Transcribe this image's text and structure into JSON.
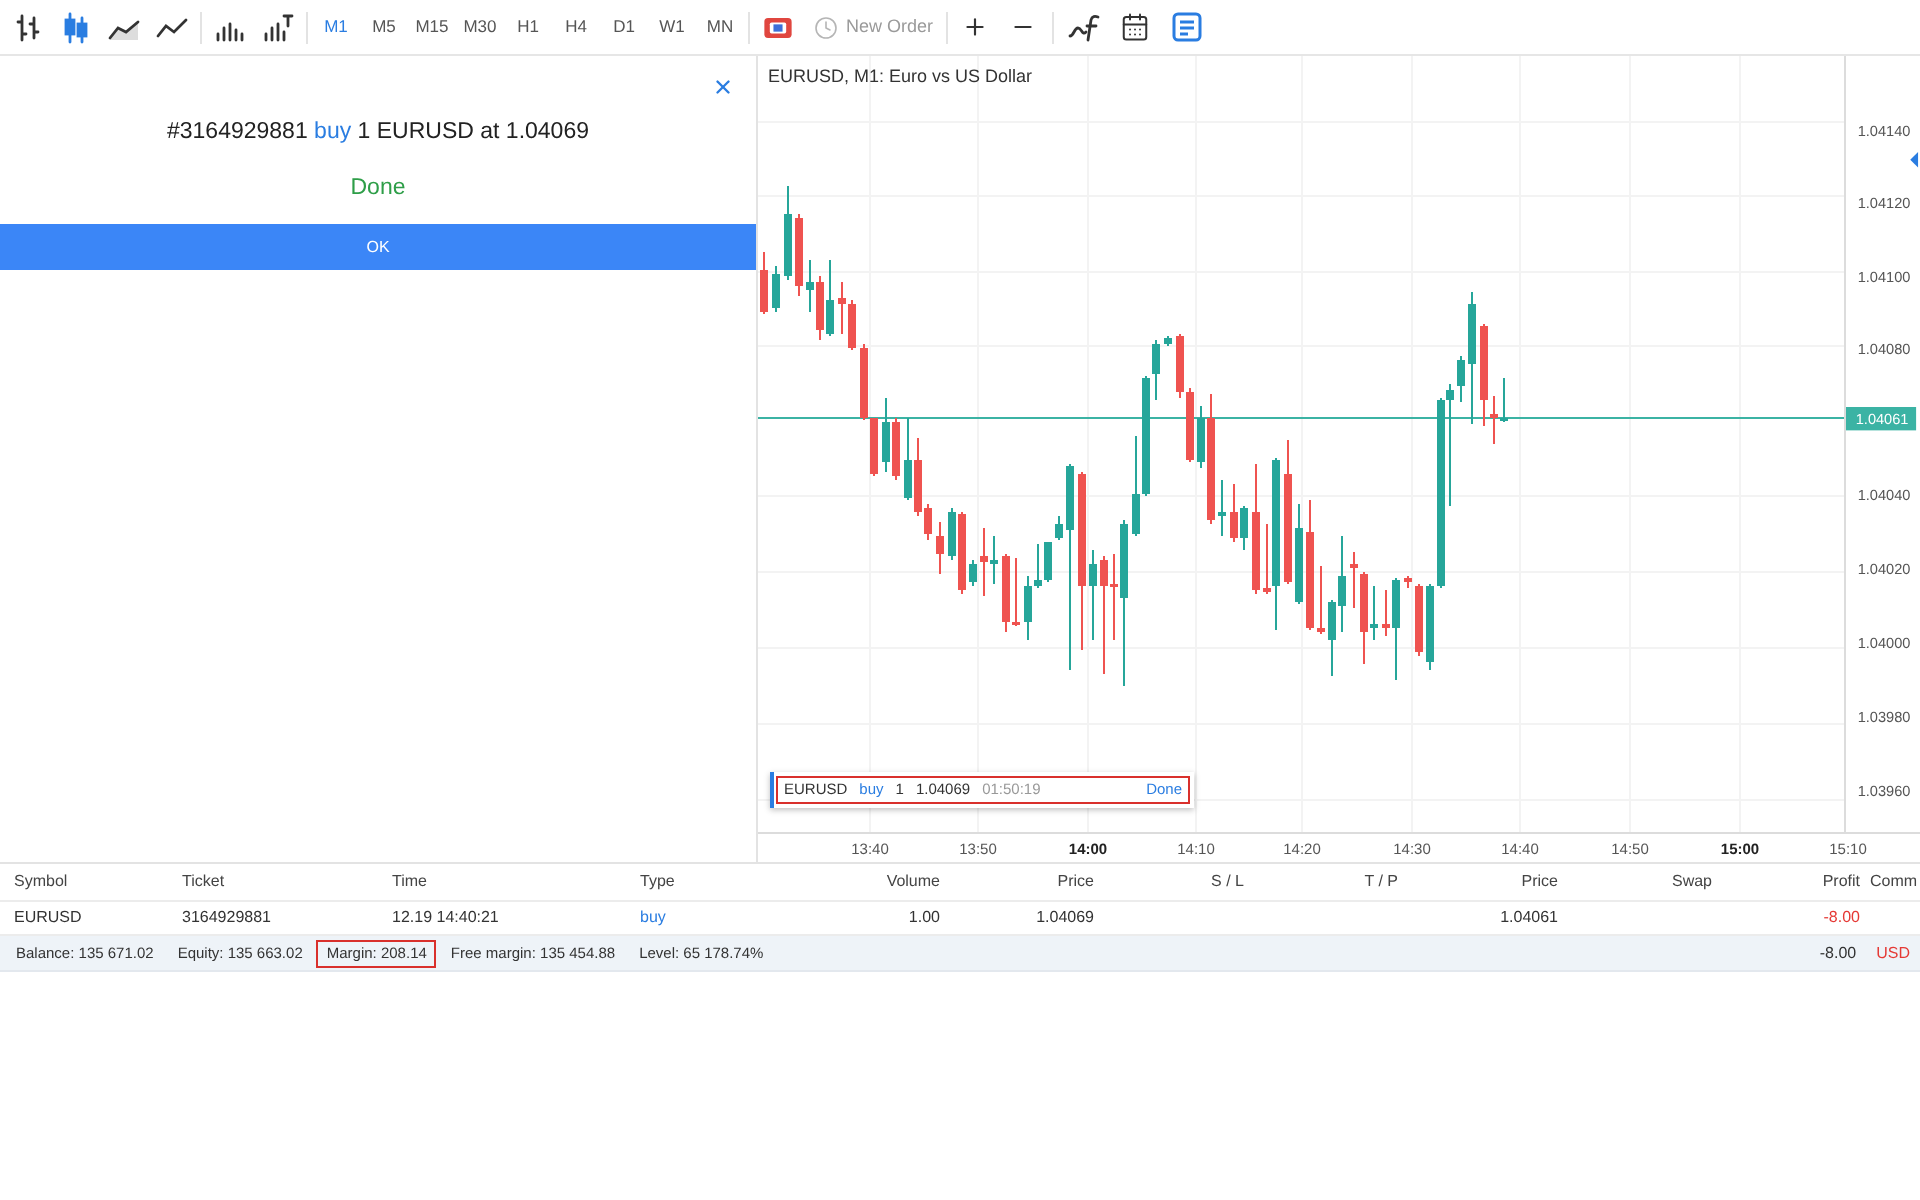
{
  "toolbar": {
    "chart_types": [
      {
        "kind": "bars",
        "selected": false
      },
      {
        "kind": "candles",
        "selected": true
      },
      {
        "kind": "area",
        "selected": false
      },
      {
        "kind": "line",
        "selected": false
      },
      {
        "kind": "volume",
        "selected": false
      },
      {
        "kind": "tick-volume",
        "selected": false
      }
    ],
    "timeframes": [
      {
        "label": "M1",
        "selected": true
      },
      {
        "label": "M5",
        "selected": false
      },
      {
        "label": "M15",
        "selected": false
      },
      {
        "label": "M30",
        "selected": false
      },
      {
        "label": "H1",
        "selected": false
      },
      {
        "label": "H4",
        "selected": false
      },
      {
        "label": "D1",
        "selected": false
      },
      {
        "label": "W1",
        "selected": false
      },
      {
        "label": "MN",
        "selected": false
      }
    ],
    "new_order": {
      "label": "New Order",
      "disabled": true
    },
    "tools": [
      {
        "kind": "zoom-in",
        "selected": false
      },
      {
        "kind": "zoom-out",
        "selected": false
      },
      {
        "kind": "indicators",
        "selected": false
      },
      {
        "kind": "calendar",
        "selected": false
      },
      {
        "kind": "notes",
        "selected": true
      }
    ]
  },
  "order_result": {
    "ticket": "#3164929881",
    "side": "buy",
    "details": "1 EURUSD at 1.04069",
    "status": "Done",
    "ok_button": "OK"
  },
  "chart": {
    "title": "EURUSD, M1: Euro vs US Dollar",
    "price_ticks": [
      "1.04140",
      "1.04120",
      "1.04100",
      "1.04080",
      "1.04040",
      "1.04020",
      "1.04000",
      "1.03980",
      "1.03960"
    ],
    "current_price": "1.04061",
    "time_ticks": [
      {
        "label": "13:40",
        "bold": false
      },
      {
        "label": "13:50",
        "bold": false
      },
      {
        "label": "14:00",
        "bold": true
      },
      {
        "label": "14:10",
        "bold": false
      },
      {
        "label": "14:20",
        "bold": false
      },
      {
        "label": "14:30",
        "bold": false
      },
      {
        "label": "14:40",
        "bold": false
      },
      {
        "label": "14:50",
        "bold": false
      },
      {
        "label": "15:00",
        "bold": true
      },
      {
        "label": "15:10",
        "bold": false
      }
    ],
    "trade": {
      "symbol": "EURUSD",
      "side": "buy",
      "volume": "1",
      "price": "1.04069",
      "time": "01:50:19",
      "status": "Done",
      "highlighted": true
    }
  },
  "positions": {
    "columns": [
      "Symbol",
      "Ticket",
      "Time",
      "Type",
      "Volume",
      "Price",
      "S / L",
      "T / P",
      "Price",
      "Swap",
      "Profit",
      "Comm"
    ],
    "rows": [
      {
        "symbol": "EURUSD",
        "ticket": "3164929881",
        "time": "12.19 14:40:21",
        "type": "buy",
        "volume": "1.00",
        "price": "1.04069",
        "current_price": "1.04061",
        "profit": "-8.00"
      }
    ],
    "summary": {
      "items": [
        {
          "text": "Balance: 135 671.02",
          "highlighted": false
        },
        {
          "text": "Equity: 135 663.02",
          "highlighted": false
        },
        {
          "text": "Margin: 208.14",
          "highlighted": true
        },
        {
          "text": "Free margin: 135 454.88",
          "highlighted": false
        },
        {
          "text": "Level: 65 178.74%",
          "highlighted": false
        }
      ],
      "profit": "-8.00",
      "currency": "USD"
    }
  }
}
